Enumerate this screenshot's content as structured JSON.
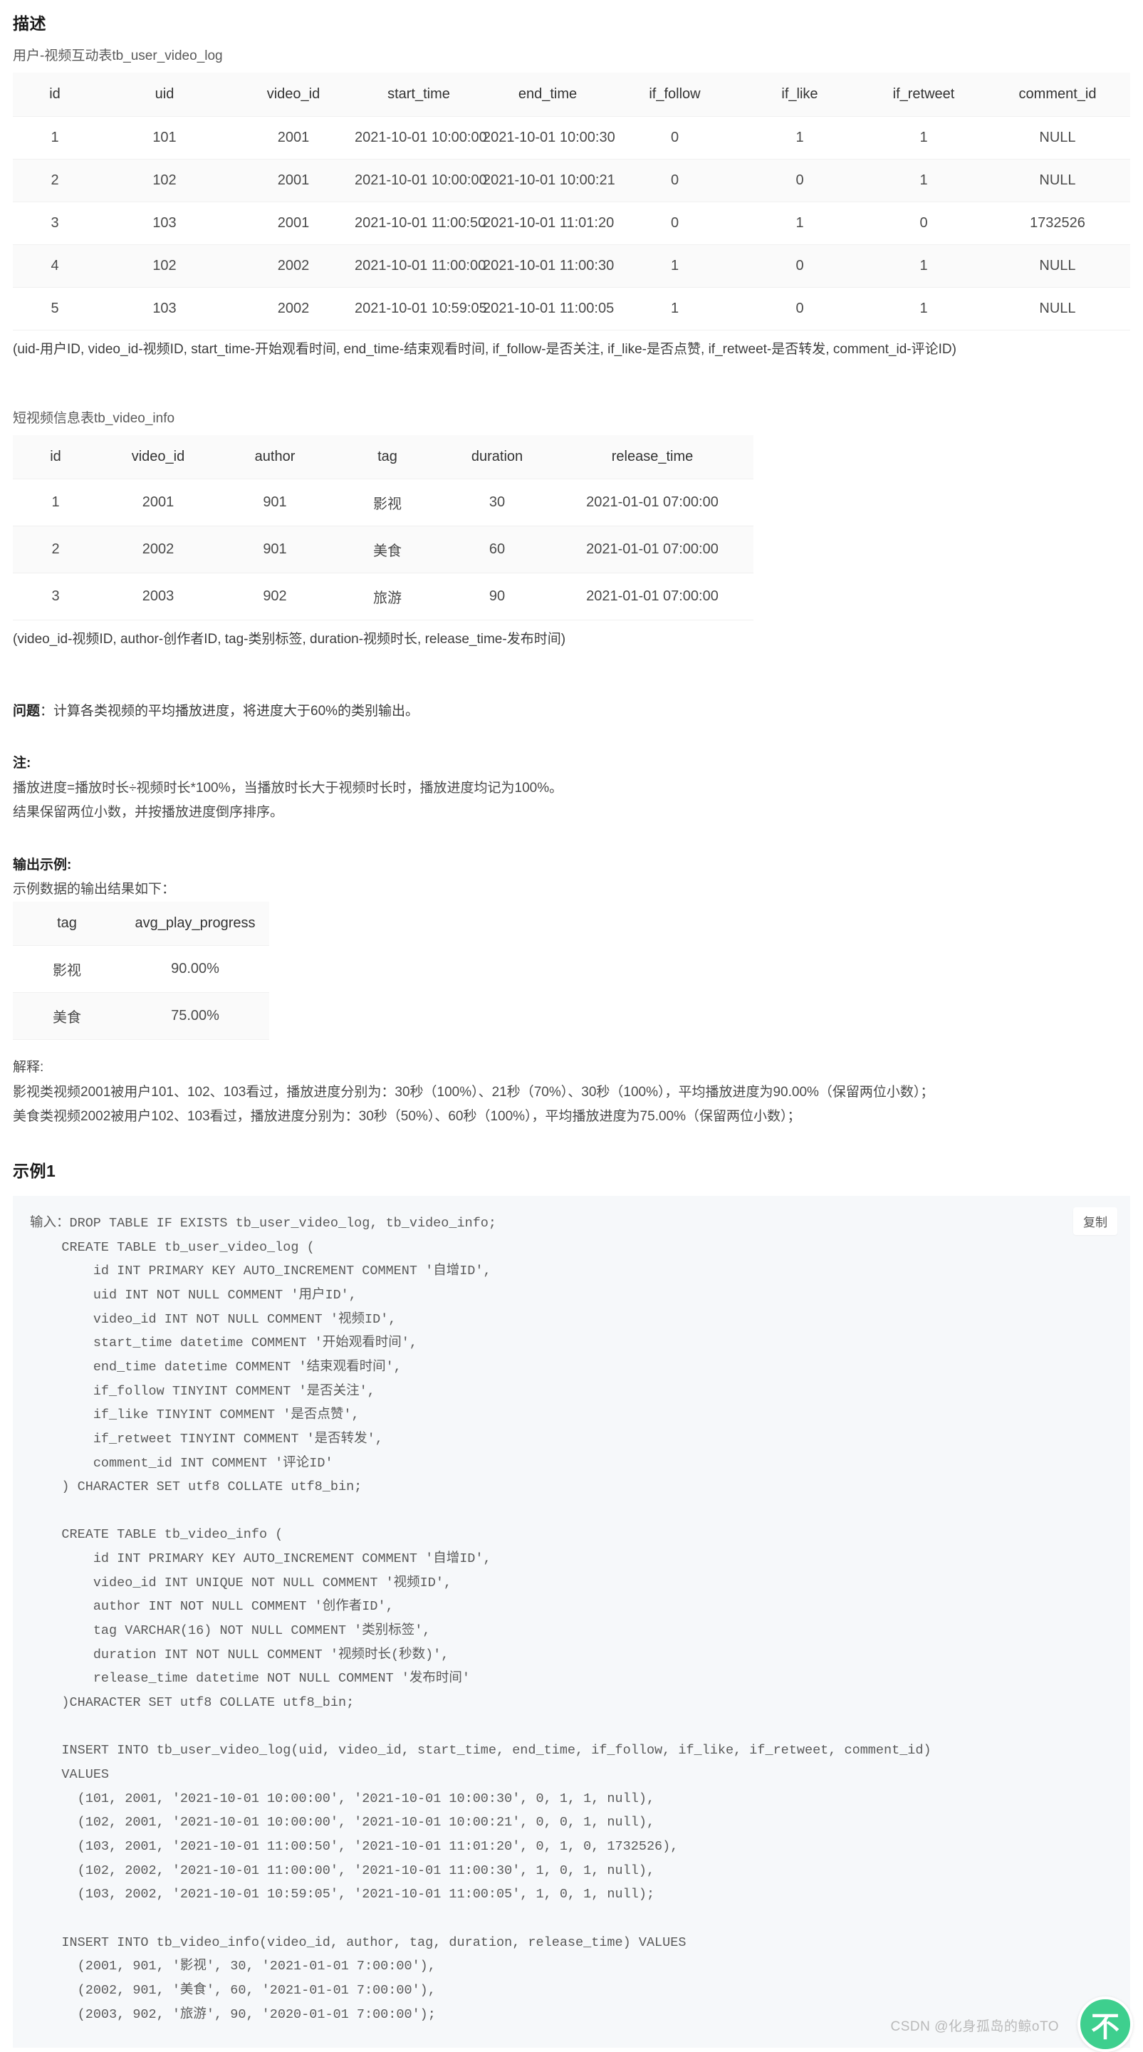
{
  "section": {
    "description_title": "描述",
    "example_title": "示例1"
  },
  "table1": {
    "caption_top": "用户-视频互动表tb_user_video_log",
    "caption_bottom": "(uid-用户ID, video_id-视频ID, start_time-开始观看时间, end_time-结束观看时间, if_follow-是否关注, if_like-是否点赞, if_retweet-是否转发, comment_id-评论ID)",
    "headers": [
      "id",
      "uid",
      "video_id",
      "start_time",
      "end_time",
      "if_follow",
      "if_like",
      "if_retweet",
      "comment_id"
    ],
    "rows": [
      [
        "1",
        "101",
        "2001",
        "2021-10-01 10:00:00",
        "2021-10-01 10:00:30",
        "0",
        "1",
        "1",
        "NULL"
      ],
      [
        "2",
        "102",
        "2001",
        "2021-10-01 10:00:00",
        "2021-10-01 10:00:21",
        "0",
        "0",
        "1",
        "NULL"
      ],
      [
        "3",
        "103",
        "2001",
        "2021-10-01 11:00:50",
        "2021-10-01 11:01:20",
        "0",
        "1",
        "0",
        "1732526"
      ],
      [
        "4",
        "102",
        "2002",
        "2021-10-01 11:00:00",
        "2021-10-01 11:00:30",
        "1",
        "0",
        "1",
        "NULL"
      ],
      [
        "5",
        "103",
        "2002",
        "2021-10-01 10:59:05",
        "2021-10-01 11:00:05",
        "1",
        "0",
        "1",
        "NULL"
      ]
    ]
  },
  "table2": {
    "caption_top": "短视频信息表tb_video_info",
    "caption_bottom": "(video_id-视频ID, author-创作者ID, tag-类别标签, duration-视频时长, release_time-发布时间)",
    "headers": [
      "id",
      "video_id",
      "author",
      "tag",
      "duration",
      "release_time"
    ],
    "rows": [
      [
        "1",
        "2001",
        "901",
        "影视",
        "30",
        "2021-01-01 07:00:00"
      ],
      [
        "2",
        "2002",
        "901",
        "美食",
        "60",
        "2021-01-01 07:00:00"
      ],
      [
        "3",
        "2003",
        "902",
        "旅游",
        "90",
        "2021-01-01 07:00:00"
      ]
    ]
  },
  "question": {
    "label": "问题",
    "text": "：计算各类视频的平均播放进度，将进度大于60%的类别输出。"
  },
  "note": {
    "label": "注:",
    "line1": "播放进度=播放时长÷视频时长*100%，当播放时长大于视频时长时，播放进度均记为100%。",
    "line2": "结果保留两位小数，并按播放进度倒序排序。"
  },
  "output_example": {
    "label": "输出示例:",
    "sub": "示例数据的输出结果如下：",
    "headers": [
      "tag",
      "avg_play_progress"
    ],
    "rows": [
      [
        "影视",
        "90.00%"
      ],
      [
        "美食",
        "75.00%"
      ]
    ]
  },
  "explanation": {
    "label": "解释:",
    "line1": "影视类视频2001被用户101、102、103看过，播放进度分别为：30秒（100%）、21秒（70%）、30秒（100%），平均播放进度为90.00%（保留两位小数）；",
    "line2": "美食类视频2002被用户102、103看过，播放进度分别为：30秒（50%）、60秒（100%），平均播放进度为75.00%（保留两位小数）；"
  },
  "code_block": {
    "copy_label": "复制",
    "content": "输入：DROP TABLE IF EXISTS tb_user_video_log, tb_video_info;\n    CREATE TABLE tb_user_video_log (\n        id INT PRIMARY KEY AUTO_INCREMENT COMMENT '自增ID',\n        uid INT NOT NULL COMMENT '用户ID',\n        video_id INT NOT NULL COMMENT '视频ID',\n        start_time datetime COMMENT '开始观看时间',\n        end_time datetime COMMENT '结束观看时间',\n        if_follow TINYINT COMMENT '是否关注',\n        if_like TINYINT COMMENT '是否点赞',\n        if_retweet TINYINT COMMENT '是否转发',\n        comment_id INT COMMENT '评论ID'\n    ) CHARACTER SET utf8 COLLATE utf8_bin;\n\n    CREATE TABLE tb_video_info (\n        id INT PRIMARY KEY AUTO_INCREMENT COMMENT '自增ID',\n        video_id INT UNIQUE NOT NULL COMMENT '视频ID',\n        author INT NOT NULL COMMENT '创作者ID',\n        tag VARCHAR(16) NOT NULL COMMENT '类别标签',\n        duration INT NOT NULL COMMENT '视频时长(秒数)',\n        release_time datetime NOT NULL COMMENT '发布时间'\n    )CHARACTER SET utf8 COLLATE utf8_bin;\n\n    INSERT INTO tb_user_video_log(uid, video_id, start_time, end_time, if_follow, if_like, if_retweet, comment_id)\n    VALUES\n      (101, 2001, '2021-10-01 10:00:00', '2021-10-01 10:00:30', 0, 1, 1, null),\n      (102, 2001, '2021-10-01 10:00:00', '2021-10-01 10:00:21', 0, 0, 1, null),\n      (103, 2001, '2021-10-01 11:00:50', '2021-10-01 11:01:20', 0, 1, 0, 1732526),\n      (102, 2002, '2021-10-01 11:00:00', '2021-10-01 11:00:30', 1, 0, 1, null),\n      (103, 2002, '2021-10-01 10:59:05', '2021-10-01 11:00:05', 1, 0, 1, null);\n\n    INSERT INTO tb_video_info(video_id, author, tag, duration, release_time) VALUES\n      (2001, 901, '影视', 30, '2021-01-01 7:00:00'),\n      (2002, 901, '美食', 60, '2021-01-01 7:00:00'),\n      (2003, 902, '旅游', 90, '2020-01-01 7:00:00');"
  },
  "watermark": {
    "text": "CSDN @化身孤岛的鲸oTO",
    "badge_glyph": "不"
  }
}
